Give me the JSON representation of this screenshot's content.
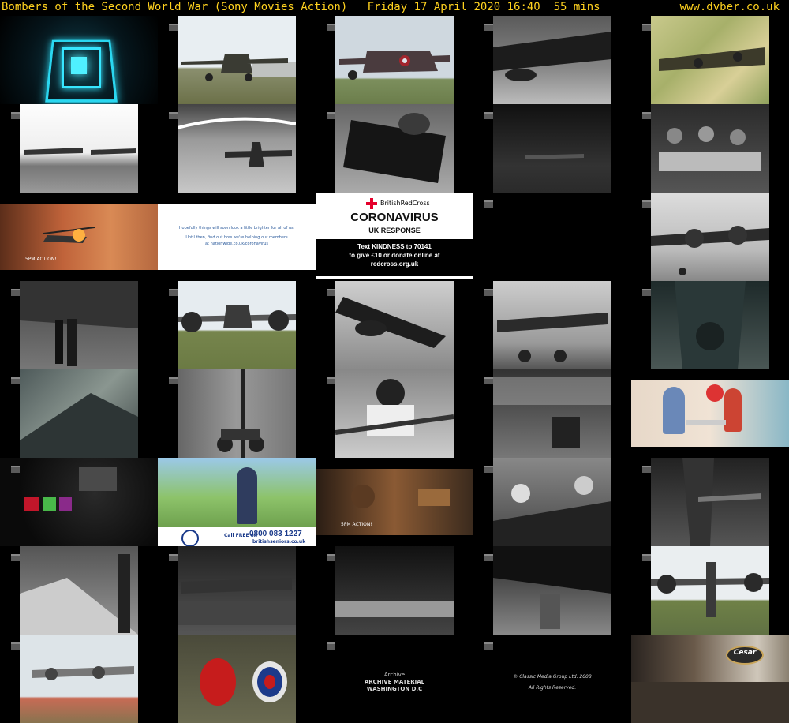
{
  "header": {
    "title": "Bombers of the Second World War (Sony Movies Action)",
    "datetime": "Friday 17 April 2020  16:40",
    "duration": "55 mins",
    "site": "www.dvber.co.uk"
  },
  "ads": {
    "nationwide_line1": "Hopefully things will soon look a little brighter for all of us.",
    "nationwide_line2": "Until then, find out how we're helping our members",
    "nationwide_line3": "at nationwide.co.uk/coronavirus",
    "redcross_brand": "BritishRedCross",
    "redcross_title": "CORONAVIRUS",
    "redcross_sub": "UK RESPONSE",
    "redcross_text1": "Text KINDNESS to 70141",
    "redcross_text2": "to give £10 or donate online at",
    "redcross_text3": "redcross.org.uk",
    "seniors_phone": "0800 083 1227",
    "seniors_call": "Call FREE on",
    "seniors_site": "britishseniors.co.uk",
    "archive1": "Archive",
    "archive2": "ARCHIVE MATERIAL",
    "archive3": "WASHINGTON D.C",
    "classic1": "© Classic Media Group Ltd. 2008",
    "classic2": "All Rights Reserved.",
    "cesar": "Cesar",
    "movie_action": "5PM ACTION!"
  }
}
